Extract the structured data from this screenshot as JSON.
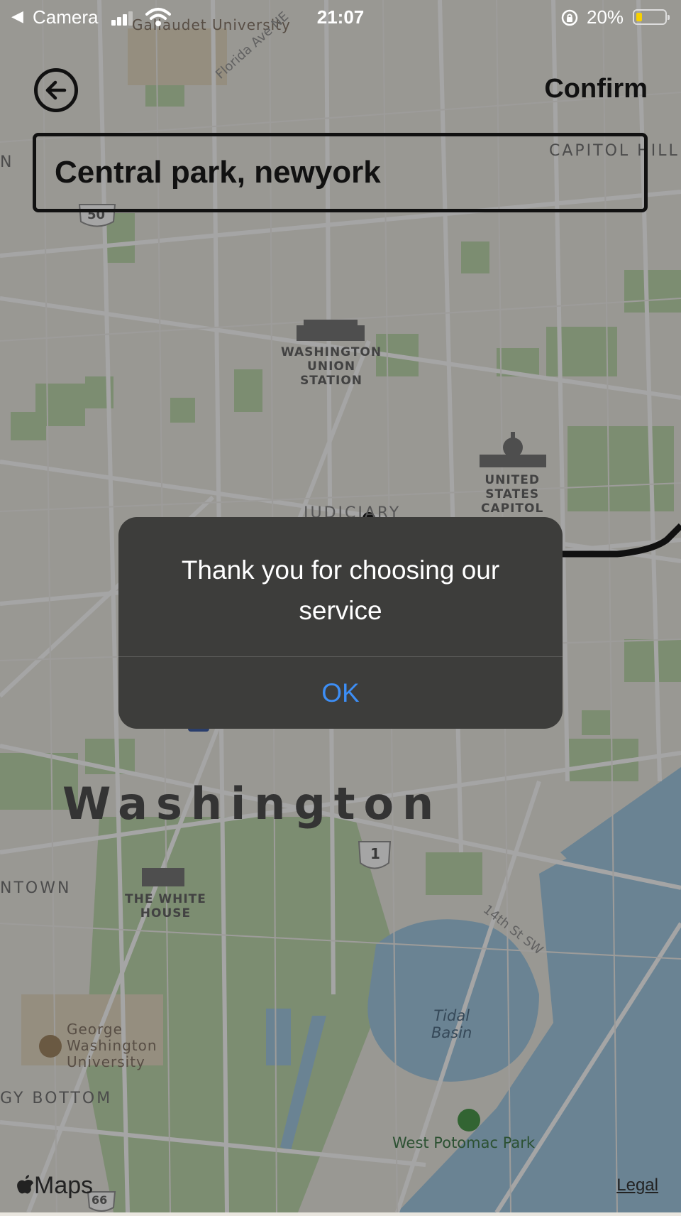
{
  "status_bar": {
    "back_glyph": "◀",
    "back_app": "Camera",
    "time": "21:07",
    "battery_percent": "20%",
    "battery_level": 0.2,
    "icons": [
      "signal-icon",
      "wifi-icon",
      "orientation-lock-icon",
      "battery-icon"
    ]
  },
  "header": {
    "back_icon": "arrow-left-circle-icon",
    "confirm_label": "Confirm"
  },
  "search": {
    "value": "Central park, newyork"
  },
  "map": {
    "labels": {
      "gallaudet": "Gallaudet\nUniversity",
      "florida_ave": "Florida Ave NE",
      "capitol_hill": "CAPITOL HILL",
      "n_edge": "N",
      "highway_50": "50",
      "union_station": "WASHINGTON\nUNION\nSTATION",
      "capitol": "UNITED\nSTATES\nCAPITOL",
      "judiciary": "JUDICIARY",
      "washington": "Washington",
      "highway_1": "1",
      "ntown": "NTOWN",
      "white_house": "THE WHITE\nHOUSE",
      "street_14th": "14th St SW",
      "tidal_basin": "Tidal\nBasin",
      "george_washington": "George\nWashington\nUniversity",
      "foggy_bottom": "GY BOTTOM",
      "west_potomac": "West Potomac Park",
      "highway_66": "66"
    }
  },
  "alert": {
    "message": "Thank you for choosing our service",
    "ok_label": "OK"
  },
  "footer": {
    "maps_logo": "Maps",
    "legal_label": "Legal"
  }
}
